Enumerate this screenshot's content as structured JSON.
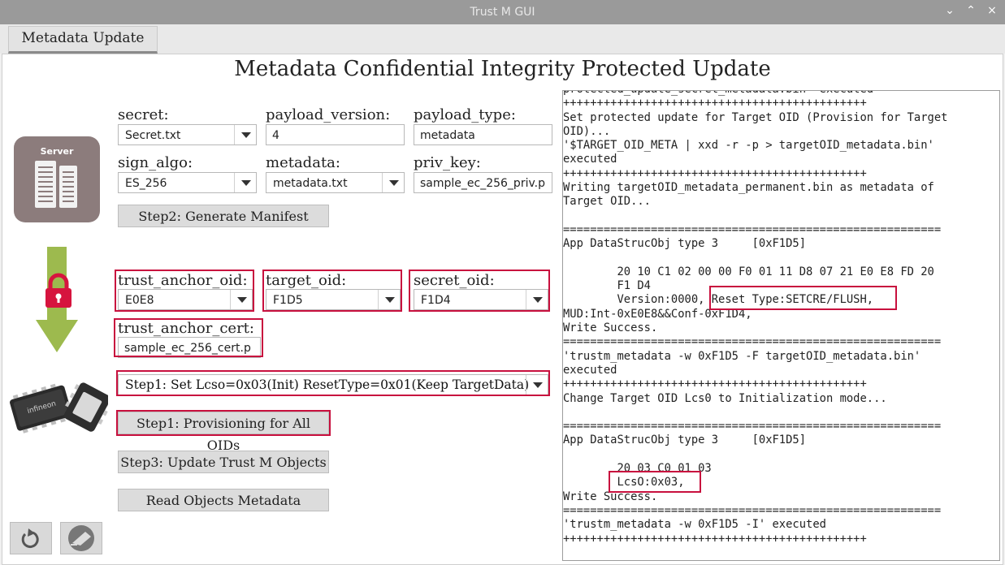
{
  "window": {
    "title": "Trust M GUI",
    "controls": [
      "⌄",
      "⌃",
      "×"
    ]
  },
  "tab": {
    "label": "Metadata Update"
  },
  "heading": "Metadata Confidential Integrity Protected Update",
  "server_label": "Server",
  "fields": {
    "secret": {
      "label": "secret:",
      "value": "Secret.txt"
    },
    "payload_version": {
      "label": "payload_version:",
      "value": "4"
    },
    "payload_type": {
      "label": "payload_type:",
      "value": "metadata"
    },
    "sign_algo": {
      "label": "sign_algo:",
      "value": "ES_256"
    },
    "metadata": {
      "label": "metadata:",
      "value": "metadata.txt"
    },
    "priv_key": {
      "label": "priv_key:",
      "value": "sample_ec_256_priv.p"
    },
    "trust_anchor_oid": {
      "label": "trust_anchor_oid:",
      "value": "E0E8"
    },
    "target_oid": {
      "label": "target_oid:",
      "value": "F1D5"
    },
    "secret_oid": {
      "label": "secret_oid:",
      "value": "F1D4"
    },
    "trust_anchor_cert": {
      "label": "trust_anchor_cert:",
      "value": "sample_ec_256_cert.p"
    },
    "step1_option": {
      "value": "Step1: Set Lcso=0x03(Init) ResetType=0x01(Keep TargetData)"
    }
  },
  "buttons": {
    "generate_manifest": "Step2: Generate Manifest",
    "provisioning": "Step1: Provisioning for All OIDs",
    "update_objects": "Step3: Update Trust M Objects",
    "read_metadata": "Read Objects Metadata"
  },
  "console_lines": [
    "protected_update_secret_metadata.bin' executed",
    "+++++++++++++++++++++++++++++++++++++++++++++",
    "Set protected update for Target OID (Provision for Target",
    "OID)...",
    "'$TARGET_OID_META | xxd -r -p > targetOID_metadata.bin'",
    "executed",
    "+++++++++++++++++++++++++++++++++++++++++++++",
    "Writing targetOID_metadata_permanent.bin as metadata of",
    "Target OID...",
    "",
    "========================================================",
    "App DataStrucObj type 3     [0xF1D5]",
    "",
    "        20 10 C1 02 00 00 F0 01 11 D8 07 21 E0 E8 FD 20",
    "        F1 D4",
    "        Version:0000, Reset Type:SETCRE/FLUSH,",
    "MUD:Int-0xE0E8&&Conf-0xF1D4,",
    "Write Success.",
    "========================================================",
    "'trustm_metadata -w 0xF1D5 -F targetOID_metadata.bin'",
    "executed",
    "+++++++++++++++++++++++++++++++++++++++++++++",
    "Change Target OID Lcs0 to Initialization mode...",
    "",
    "========================================================",
    "App DataStrucObj type 3     [0xF1D5]",
    "",
    "        20 03 C0 01 03",
    "        LcsO:0x03,",
    "Write Success.",
    "========================================================",
    "'trustm_metadata -w 0xF1D5 -I' executed",
    "+++++++++++++++++++++++++++++++++++++++++++++"
  ],
  "colors": {
    "highlight": "#c8103e",
    "arrow": "#9dba4e",
    "lock": "#d6143e"
  },
  "icons": [
    "server-icon",
    "lock-icon",
    "down-arrow-icon",
    "chip-icon",
    "reset-icon",
    "clear-icon"
  ]
}
